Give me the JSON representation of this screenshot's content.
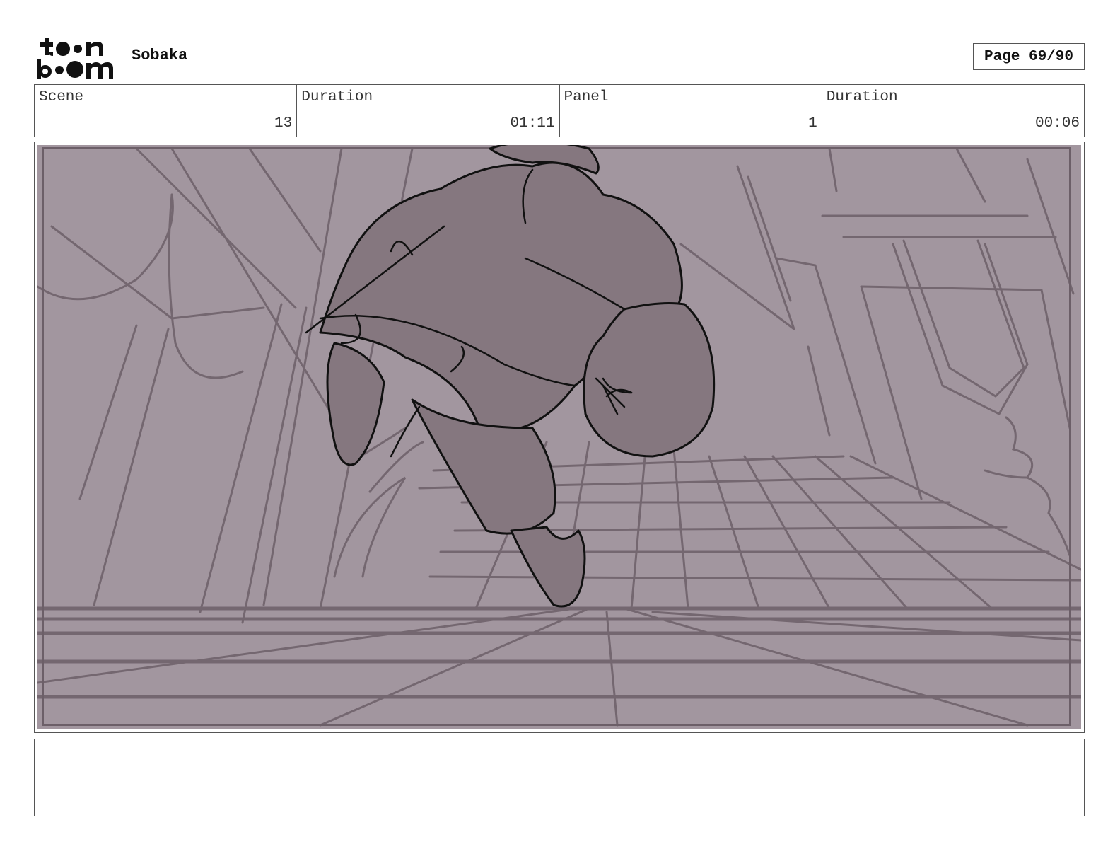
{
  "header": {
    "logo_text": "toon boom",
    "project_title": "Sobaka",
    "page_label": "Page 69/90"
  },
  "info": {
    "scene_label": "Scene",
    "scene_value": "13",
    "scene_duration_label": "Duration",
    "scene_duration_value": "01:11",
    "panel_label": "Panel",
    "panel_value": "1",
    "panel_duration_label": "Duration",
    "panel_duration_value": "00:06"
  },
  "panel": {
    "background_color": "#a2969f",
    "figure_color": "#85777f",
    "line_color": "#6c5f68"
  },
  "notes": {
    "text": ""
  }
}
